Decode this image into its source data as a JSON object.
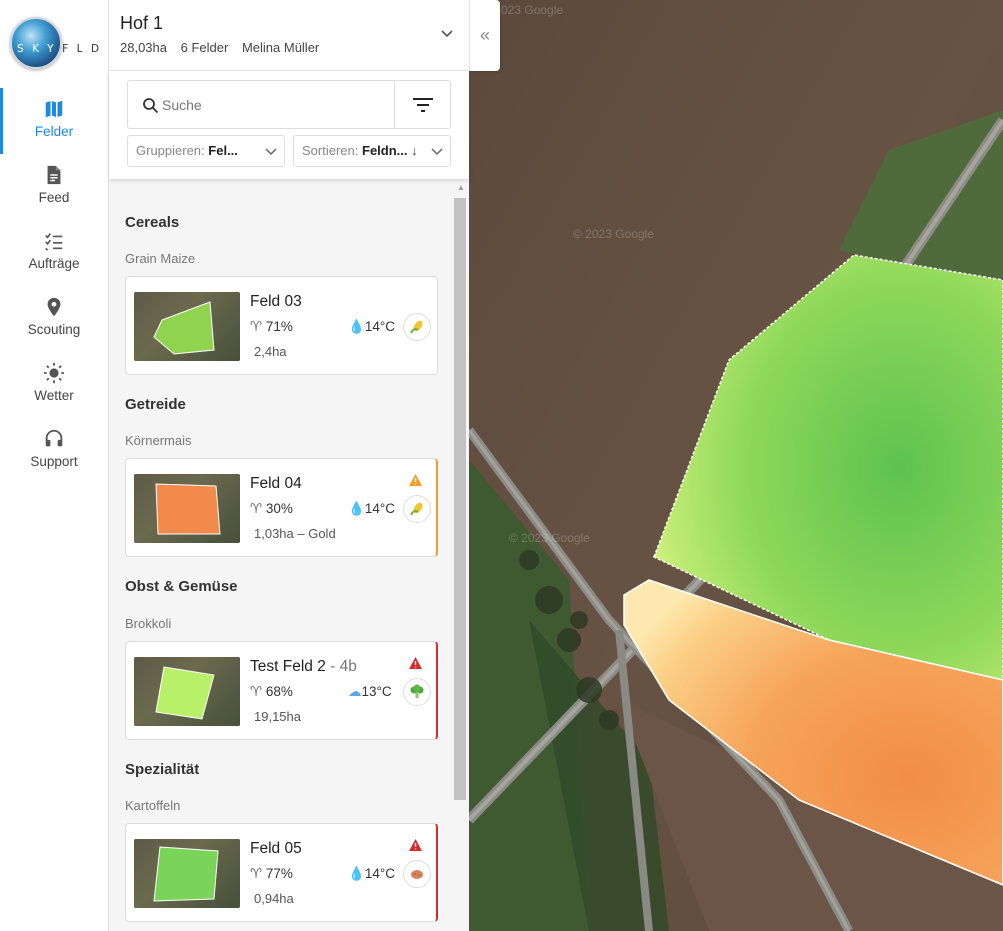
{
  "brand": {
    "logo_text_light": "SKY",
    "logo_text_dark": "FLD"
  },
  "nav": [
    {
      "label": "Felder",
      "icon": "map-icon",
      "active": true
    },
    {
      "label": "Feed",
      "icon": "document-icon",
      "active": false
    },
    {
      "label": "Aufträge",
      "icon": "checklist-icon",
      "active": false
    },
    {
      "label": "Scouting",
      "icon": "location-pin-icon",
      "active": false
    },
    {
      "label": "Wetter",
      "icon": "sun-icon",
      "active": false
    },
    {
      "label": "Support",
      "icon": "headset-icon",
      "active": false
    }
  ],
  "farm": {
    "title": "Hof 1",
    "area": "28,03ha",
    "field_count": "6 Felder",
    "owner": "Melina Müller"
  },
  "search": {
    "placeholder": "Suche"
  },
  "grouping": {
    "label": "Gruppieren:",
    "value": "Fel..."
  },
  "sorting": {
    "label": "Sortieren:",
    "value": "Feldn...",
    "direction_icon": "arrow-down-icon"
  },
  "groups": [
    {
      "title": "Cereals",
      "crop": "Grain Maize",
      "field": {
        "name": "Feld 03",
        "sub": "",
        "growth": "71%",
        "temp": "14°C",
        "weather": "rain-icon",
        "area": "2,4ha",
        "crop_icon": "corn-icon",
        "status": "none",
        "field_color": "#8fd34f"
      }
    },
    {
      "title": "Getreide",
      "crop": "Körnermais",
      "field": {
        "name": "Feld 04",
        "sub": "",
        "growth": "30%",
        "temp": "14°C",
        "weather": "rain-icon",
        "area": "1,03ha – Gold",
        "crop_icon": "corn-icon",
        "status": "warning",
        "field_color": "#f18a4a"
      }
    },
    {
      "title": "Obst & Gemüse",
      "crop": "Brokkoli",
      "field": {
        "name": "Test Feld 2",
        "sub": " - 4b",
        "growth": "68%",
        "temp": "13°C",
        "weather": "cloud-rain-icon",
        "area": "19,15ha",
        "crop_icon": "broccoli-icon",
        "status": "alert",
        "field_color": "#b9f06a"
      }
    },
    {
      "title": "Spezialität",
      "crop": "Kartoffeln",
      "field": {
        "name": "Feld 05",
        "sub": "",
        "growth": "77%",
        "temp": "14°C",
        "weather": "rain-icon",
        "area": "0,94ha",
        "crop_icon": "potato-icon",
        "status": "alert",
        "field_color": "#7bd45a"
      }
    }
  ],
  "map": {
    "watermark": "© 2023 Google",
    "watermark_top_partial": "023 Google"
  },
  "colors": {
    "accent": "#1e88e5",
    "warning": "#f39c2b",
    "alert": "#d52b2b"
  }
}
